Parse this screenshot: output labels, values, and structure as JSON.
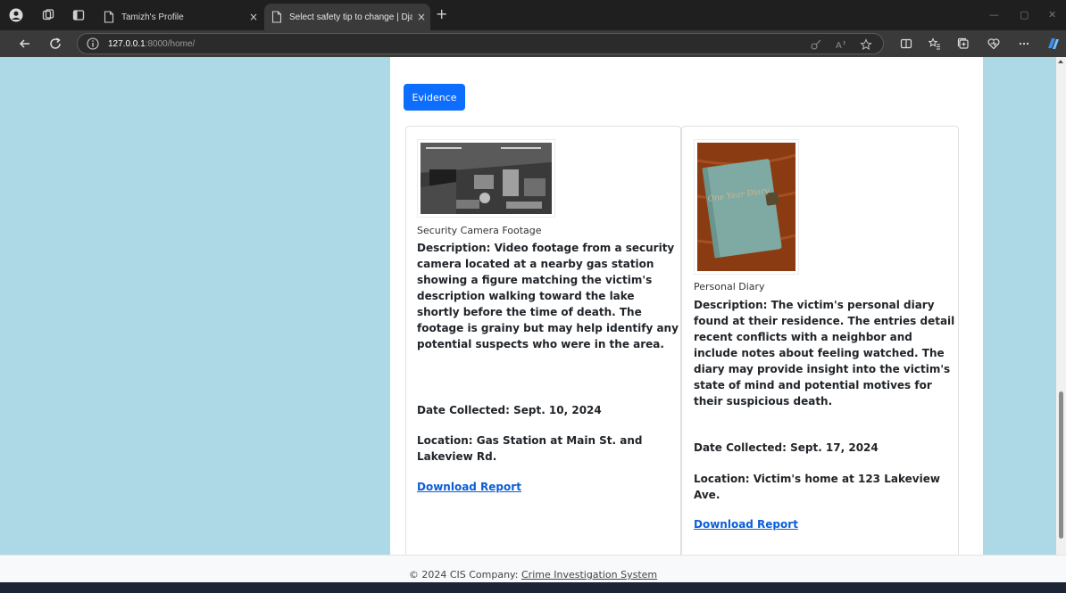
{
  "browser": {
    "tabs": [
      {
        "title": "Tamizh's Profile"
      },
      {
        "title": "Select safety tip to change | Djan"
      }
    ],
    "address": {
      "host": "127.0.0.1",
      "rest": ":8000/home/"
    }
  },
  "page": {
    "section_button": "Evidence",
    "cards": [
      {
        "title": "Security Camera Footage",
        "description": "Description: Video footage from a security camera located at a nearby gas station showing a figure matching the victim's description walking toward the lake shortly before the time of death. The footage is grainy but may help identify any potential suspects who were in the area.",
        "date": "Date Collected: Sept. 10, 2024",
        "location": "Location: Gas Station at Main St. and Lakeview Rd.",
        "download": "Download Report",
        "image_icon": "cctv-footage-image"
      },
      {
        "title": "Personal Diary",
        "description": "Description: The victim's personal diary found at their residence. The entries detail recent conflicts with a neighbor and include notes about feeling watched. The diary may provide insight into the victim's state of mind and potential motives for their suspicious death.",
        "date": "Date Collected: Sept. 17, 2024",
        "location": "Location: Victim's home at 123 Lakeview Ave.",
        "download": "Download Report",
        "image_icon": "diary-image",
        "diary_cover_text": "One Year Diary"
      }
    ],
    "footer": {
      "copyright": "© 2024 CIS Company:",
      "link": "Crime Investigation System"
    }
  },
  "colors": {
    "page_background": "#add8e6",
    "primary_button": "#0d6efd",
    "link": "#0b5ed7",
    "browser_frame": "#1f1f1f"
  }
}
